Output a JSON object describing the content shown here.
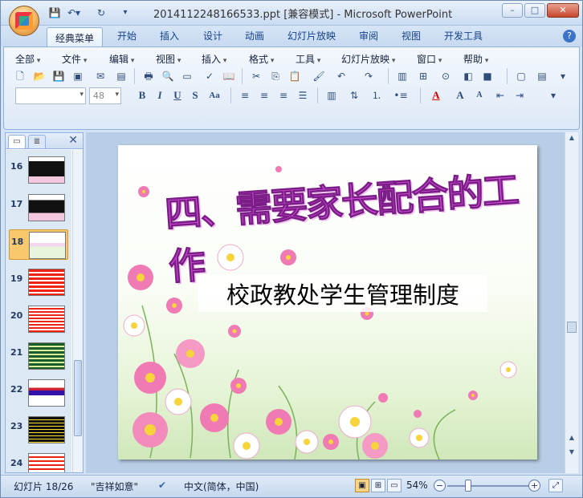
{
  "window": {
    "title": "2014112248166533.ppt [兼容模式] - Microsoft PowerPoint",
    "controls": {
      "minimize": "–",
      "maximize": "□",
      "close": "✕"
    }
  },
  "quick_access": [
    "save-icon",
    "undo-icon",
    "redo-icon",
    "customize-icon"
  ],
  "ribbon_tabs": [
    "经典菜单",
    "开始",
    "插入",
    "设计",
    "动画",
    "幻灯片放映",
    "审阅",
    "视图",
    "开发工具"
  ],
  "active_tab": "经典菜单",
  "classic_menu": [
    "全部",
    "文件",
    "编辑",
    "视图",
    "插入",
    "格式",
    "工具",
    "幻灯片放映",
    "窗口",
    "帮助"
  ],
  "toolbar": {
    "font_name": "",
    "font_size": "48",
    "bold": "B",
    "italic": "I",
    "underline": "U",
    "shadow": "S",
    "change_case": "Aa",
    "font_color_a": "A",
    "grow_a": "A",
    "shrink_a": "A"
  },
  "slides_panel": {
    "items": [
      {
        "num": "16"
      },
      {
        "num": "17"
      },
      {
        "num": "18"
      },
      {
        "num": "19"
      },
      {
        "num": "20"
      },
      {
        "num": "21"
      },
      {
        "num": "22"
      },
      {
        "num": "23"
      },
      {
        "num": "24"
      }
    ],
    "selected": "18"
  },
  "slide": {
    "title": "四、需要家长配合的工作",
    "body": "校政教处学生管理制度"
  },
  "status_bar": {
    "slide_info": "幻灯片 18/26",
    "theme": "\"吉祥如意\"",
    "language": "中文(简体，中国)",
    "zoom": "54%"
  },
  "colors": {
    "title_magenta": "#d34fd8",
    "ribbon_blue": "#dde9f7",
    "selection_orange": "#f7c86d"
  }
}
